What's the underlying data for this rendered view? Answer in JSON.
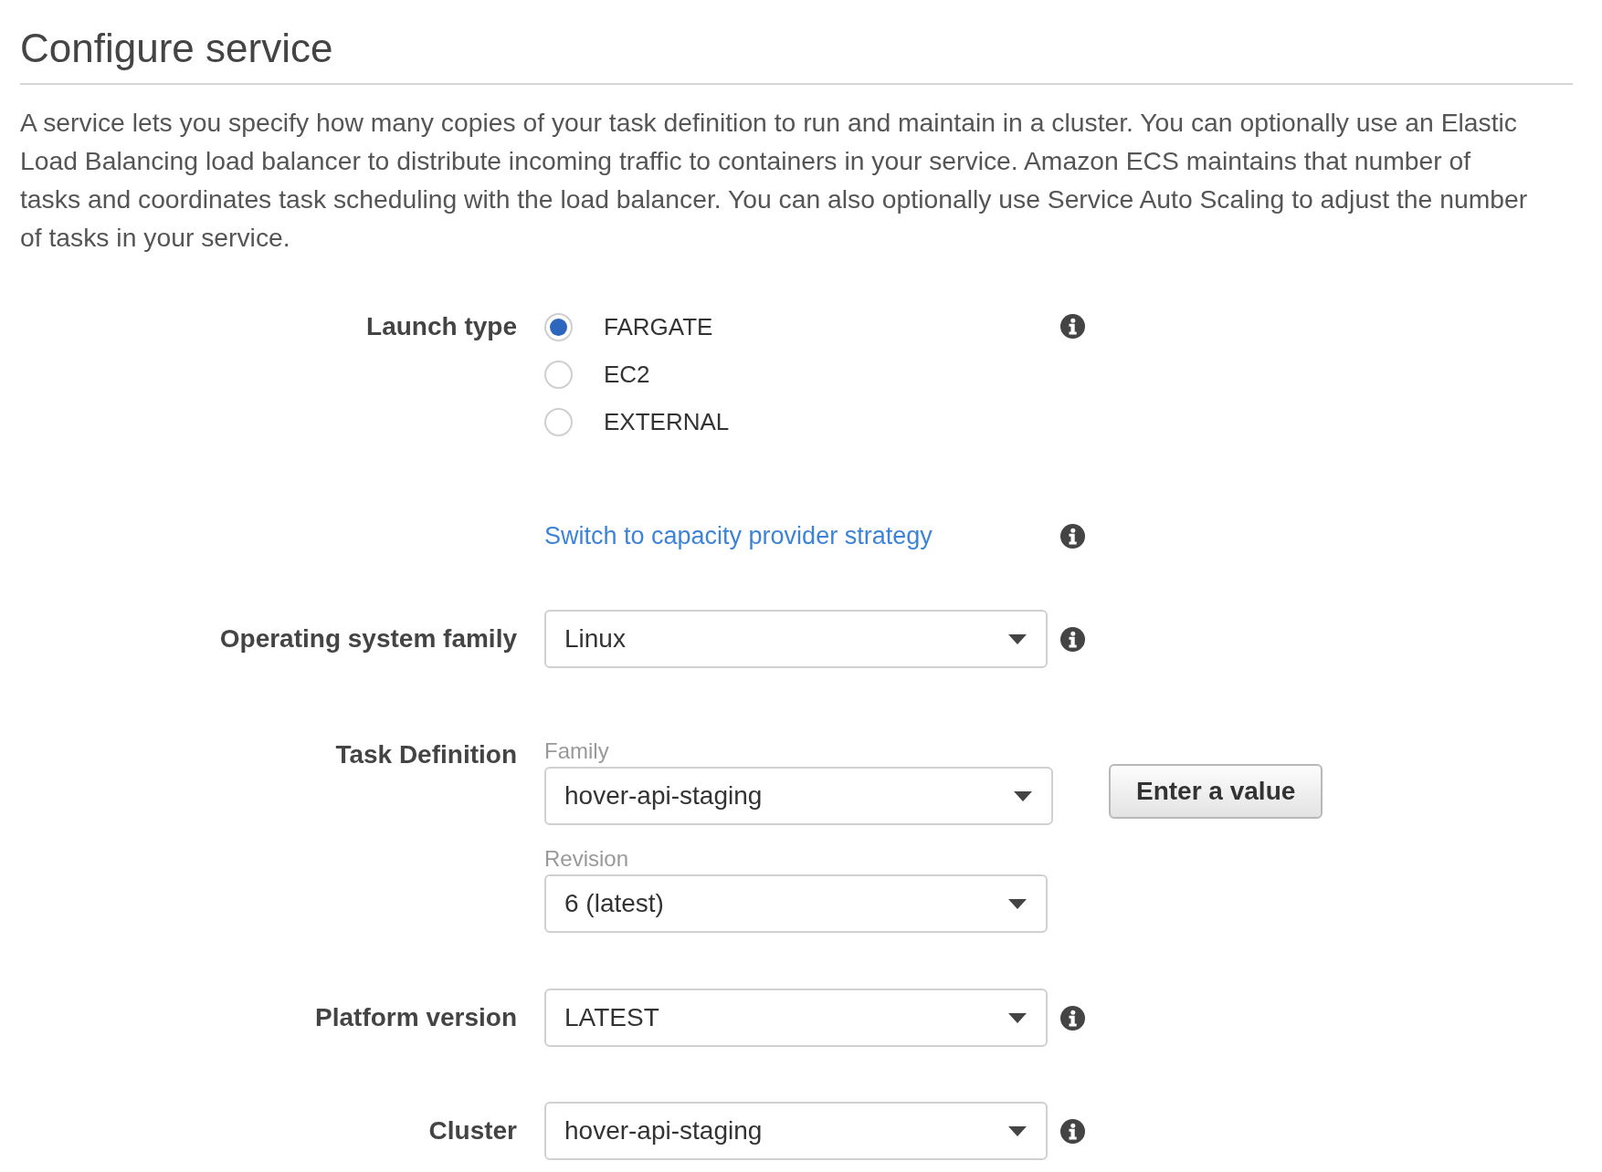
{
  "title": "Configure service",
  "description": "A service lets you specify how many copies of your task definition to run and maintain in a cluster. You can optionally use an Elastic Load Balancing load balancer to distribute incoming traffic to containers in your service. Amazon ECS maintains that number of tasks and coordinates task scheduling with the load balancer. You can also optionally use Service Auto Scaling to adjust the number of tasks in your service.",
  "form": {
    "rows": [
      {
        "kind": "radio",
        "label": "Launch type",
        "info": true,
        "options": [
          {
            "label": "FARGATE",
            "selected": true
          },
          {
            "label": "EC2",
            "selected": false
          },
          {
            "label": "EXTERNAL",
            "selected": false
          }
        ]
      },
      {
        "kind": "link",
        "text": "Switch to capacity provider strategy",
        "info": true
      },
      {
        "kind": "select",
        "label": "Operating system family",
        "value": "Linux",
        "info": true
      },
      {
        "kind": "task",
        "label": "Task Definition",
        "info": false,
        "fields": [
          {
            "label": "Family",
            "value": "hover-api-staging"
          },
          {
            "label": "Revision",
            "value": "6 (latest)"
          }
        ],
        "button": "Enter a value"
      },
      {
        "kind": "select",
        "label": "Platform version",
        "value": "LATEST",
        "info": true
      },
      {
        "kind": "select",
        "label": "Cluster",
        "value": "hover-api-staging",
        "info": true
      }
    ]
  }
}
